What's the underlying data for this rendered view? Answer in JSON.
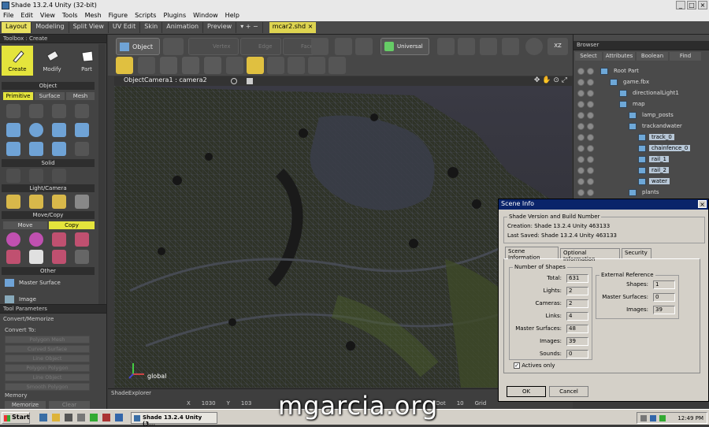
{
  "titlebar": {
    "title": "Shade 13.2.4 Unity (32-bit)"
  },
  "menu": [
    "File",
    "Edit",
    "View",
    "Tools",
    "Mesh",
    "Figure",
    "Scripts",
    "Plugins",
    "Window",
    "Help"
  ],
  "layout_tabs": [
    "Layout",
    "Modeling",
    "Split View",
    "UV Edit",
    "Skin",
    "Animation",
    "Preview",
    "▾ + −"
  ],
  "doc_tab": "mcar2.shd ×",
  "toolbox": {
    "title": "Toolbox : Create",
    "buttons": [
      "Create",
      "Modify",
      "Part"
    ],
    "sections": {
      "object": "Object",
      "solid": "Solid",
      "light": "Light/Camera",
      "move": "Move/Copy",
      "other": "Other"
    },
    "object_tabs": [
      "Primitive",
      "Surface",
      "Mesh"
    ],
    "move_tabs": [
      "Move",
      "Copy"
    ],
    "other_items": [
      "Master Surface",
      "Image"
    ]
  },
  "tool_params": {
    "title": "Tool Parameters",
    "group": "Convert/Memorize",
    "convert_to": "Convert To:",
    "rows": [
      "Polygon Mesh",
      "Curved Surface",
      "Line Object",
      "Polygon Polygon",
      "Line Object",
      "Smooth Polygon"
    ],
    "memory": "Memory",
    "memorize": "Memorize",
    "clear": "Clear"
  },
  "toolbar": {
    "object": "Object",
    "vertex": "Vertex",
    "edge": "Edge",
    "face": "Face",
    "universal": "Universal",
    "xz": "XZ"
  },
  "viewport": {
    "header": "ObjectCamera1 : camera2",
    "axis_label": "global"
  },
  "explorer": {
    "title": "ShadeExplorer",
    "coords": [
      {
        "k": "X",
        "v": "1030"
      },
      {
        "k": "Y",
        "v": "103"
      },
      {
        "k": "Dot",
        "v": "10"
      },
      {
        "k": "Grid",
        "v": ""
      }
    ]
  },
  "browser": {
    "title": "Browser",
    "tabs": [
      "Select",
      "Attributes",
      "Boolean",
      "Find"
    ],
    "tree": [
      {
        "label": "Root Part",
        "indent": 0,
        "selected": false
      },
      {
        "label": "game.fbx",
        "indent": 1,
        "selected": false
      },
      {
        "label": "directionalLight1",
        "indent": 2,
        "selected": false
      },
      {
        "label": "map",
        "indent": 2,
        "selected": false
      },
      {
        "label": "lamp_posts",
        "indent": 3,
        "selected": false
      },
      {
        "label": "trackandwater",
        "indent": 3,
        "selected": false
      },
      {
        "label": "track_0",
        "indent": 4,
        "selected": true
      },
      {
        "label": "chainfence_0",
        "indent": 4,
        "selected": true
      },
      {
        "label": "rail_1",
        "indent": 4,
        "selected": true
      },
      {
        "label": "rail_2",
        "indent": 4,
        "selected": true
      },
      {
        "label": "water",
        "indent": 4,
        "selected": true
      },
      {
        "label": "plants",
        "indent": 3,
        "selected": false
      }
    ]
  },
  "dialog": {
    "title": "Scene Info",
    "version_group": "Shade Version and Build Number",
    "creation": "Creation: Shade 13.2.4 Unity 463133",
    "last_saved": "Last Saved: Shade 13.2.4 Unity 463133",
    "tabs": [
      "Scene Information",
      "Optional Information",
      "Security"
    ],
    "shapes_group": "Number of Shapes",
    "fields": [
      {
        "label": "Total:",
        "value": "631"
      },
      {
        "label": "Lights:",
        "value": "2"
      },
      {
        "label": "Cameras:",
        "value": "2"
      },
      {
        "label": "Links:",
        "value": "4"
      },
      {
        "label": "Master Surfaces:",
        "value": "48"
      },
      {
        "label": "Images:",
        "value": "39"
      },
      {
        "label": "Sounds:",
        "value": "0"
      }
    ],
    "ext_group": "External Reference",
    "ext_fields": [
      {
        "label": "Shapes:",
        "value": "1"
      },
      {
        "label": "Master Surfaces:",
        "value": "0"
      },
      {
        "label": "Images:",
        "value": "39"
      }
    ],
    "actives_only": "Actives only",
    "ok": "OK",
    "cancel": "Cancel"
  },
  "taskbar": {
    "start": "Start",
    "app": "Shade 13.2.4 Unity (3...",
    "clock": "12:49 PM"
  },
  "watermark": "mgarcia.org"
}
